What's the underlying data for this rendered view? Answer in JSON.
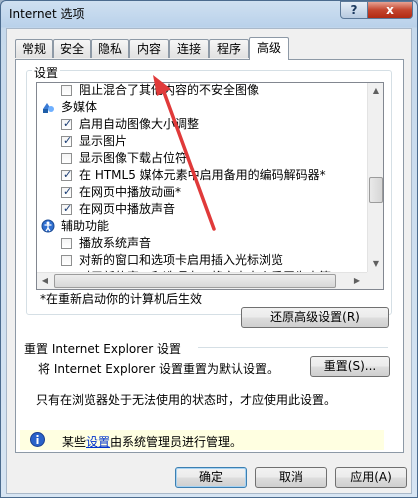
{
  "window": {
    "title": "Internet 选项",
    "help_button": "?",
    "close_button": "x"
  },
  "tabs": [
    {
      "label": "常规"
    },
    {
      "label": "安全"
    },
    {
      "label": "隐私"
    },
    {
      "label": "内容"
    },
    {
      "label": "连接"
    },
    {
      "label": "程序"
    },
    {
      "label": "高级"
    }
  ],
  "active_tab": "高级",
  "settings": {
    "group_label": "设置",
    "items": [
      {
        "type": "checkbox",
        "label": "阻止混合了其他内容的不安全图像",
        "checked": false
      },
      {
        "type": "category",
        "label": "多媒体",
        "icon": "multimedia-icon"
      },
      {
        "type": "checkbox",
        "label": "启用自动图像大小调整",
        "checked": true
      },
      {
        "type": "checkbox",
        "label": "显示图片",
        "checked": true
      },
      {
        "type": "checkbox",
        "label": "显示图像下载占位符",
        "checked": false
      },
      {
        "type": "checkbox",
        "label": "在 HTML5 媒体元素中启用备用的编码解码器*",
        "checked": true
      },
      {
        "type": "checkbox",
        "label": "在网页中播放动画*",
        "checked": true
      },
      {
        "type": "checkbox",
        "label": "在网页中播放声音",
        "checked": true
      },
      {
        "type": "category",
        "label": "辅助功能",
        "icon": "accessibility-icon"
      },
      {
        "type": "checkbox",
        "label": "播放系统声音",
        "checked": false
      },
      {
        "type": "checkbox",
        "label": "对新的窗口和选项卡启用插入光标浏览",
        "checked": false
      },
      {
        "type": "checkbox",
        "label": "对于新的窗口和选项卡，将文本大小重置为中等",
        "checked": false
      }
    ],
    "restart_note": "*在重新启动你的计算机后生效",
    "restore_button": "还原高级设置(R)"
  },
  "reset": {
    "heading": "重置 Internet Explorer 设置",
    "description": "将 Internet Explorer 设置重置为默认设置。",
    "button": "重置(S)...",
    "note": "只有在浏览器处于无法使用的状态时，才应使用此设置。"
  },
  "admin_notice": {
    "prefix": "某些",
    "link": "设置",
    "suffix": "由系统管理员进行管理。"
  },
  "footer": {
    "ok": "确定",
    "cancel": "取消",
    "apply": "应用(A)"
  },
  "colors": {
    "annotation_arrow": "#e03a3a",
    "info_bar": "#ffffe1",
    "default_button_border": "#3c7fb1"
  }
}
